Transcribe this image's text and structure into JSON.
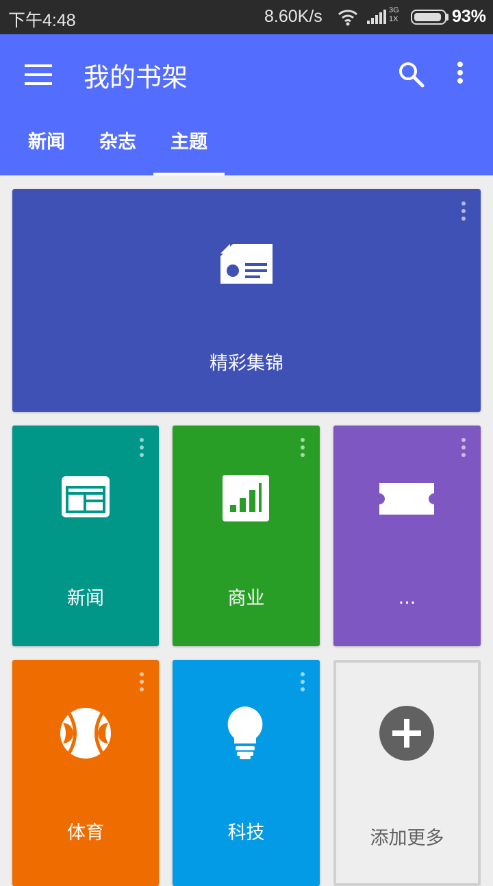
{
  "status": {
    "time": "下午4:48",
    "speed": "8.60K/s",
    "net": [
      "3G",
      "1X"
    ],
    "battery_pct": "93%",
    "battery_level": 0.93
  },
  "appbar": {
    "title": "我的书架",
    "color": "#536dfe",
    "icons": {
      "menu": "menu-icon",
      "search": "search-icon",
      "more": "more-vert-icon"
    }
  },
  "tabs": [
    {
      "label": "新闻",
      "selected": false
    },
    {
      "label": "杂志",
      "selected": false
    },
    {
      "label": "主题",
      "selected": true
    }
  ],
  "cards": {
    "highlights": {
      "label": "精彩集锦",
      "color": "#3f51b5",
      "icon": "featured-news-icon"
    },
    "news": {
      "label": "新闻",
      "color": "#009688",
      "icon": "newspaper-icon"
    },
    "business": {
      "label": "商业",
      "color": "#299e27",
      "icon": "bar-chart-icon"
    },
    "entertainment": {
      "label": "...",
      "color": "#7e57c2",
      "icon": "ticket-icon"
    },
    "sports": {
      "label": "体育",
      "color": "#ef6c00",
      "icon": "tennis-ball-icon"
    },
    "tech": {
      "label": "科技",
      "color": "#039be5",
      "icon": "lightbulb-icon"
    },
    "add_more": {
      "label": "添加更多",
      "icon": "add-circle-icon"
    }
  }
}
